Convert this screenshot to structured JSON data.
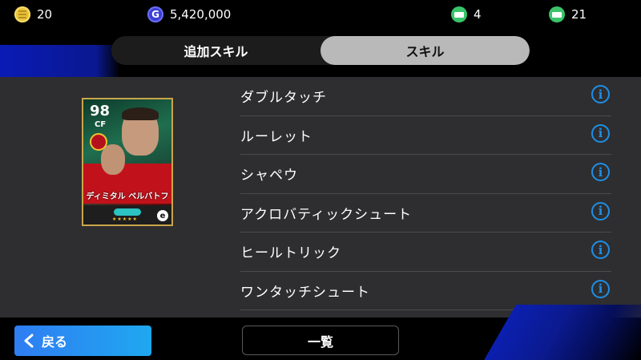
{
  "currencies": {
    "coins": "20",
    "gp": "5,420,000",
    "tickets_a": "4",
    "tickets_b": "21",
    "gp_icon_letter": "G"
  },
  "tabs": [
    {
      "label": "追加スキル",
      "active": false
    },
    {
      "label": "スキル",
      "active": true
    }
  ],
  "card": {
    "rating": "98",
    "position": "CF",
    "name": "ディミタル ベルバトフ",
    "stars": "★★★★★",
    "brand_letter": "e"
  },
  "skills": [
    {
      "label": "ダブルタッチ"
    },
    {
      "label": "ルーレット"
    },
    {
      "label": "シャペウ"
    },
    {
      "label": "アクロバティックシュート"
    },
    {
      "label": "ヒールトリック"
    },
    {
      "label": "ワンタッチシュート"
    },
    {
      "label": ""
    }
  ],
  "info_glyph": "i",
  "footer": {
    "back_label": "戻る",
    "list_label": "一覧"
  },
  "colors": {
    "accent_blue": "#1e8fe6",
    "panel_bg": "#2e2e30",
    "tab_active": "#b9b9b9"
  }
}
